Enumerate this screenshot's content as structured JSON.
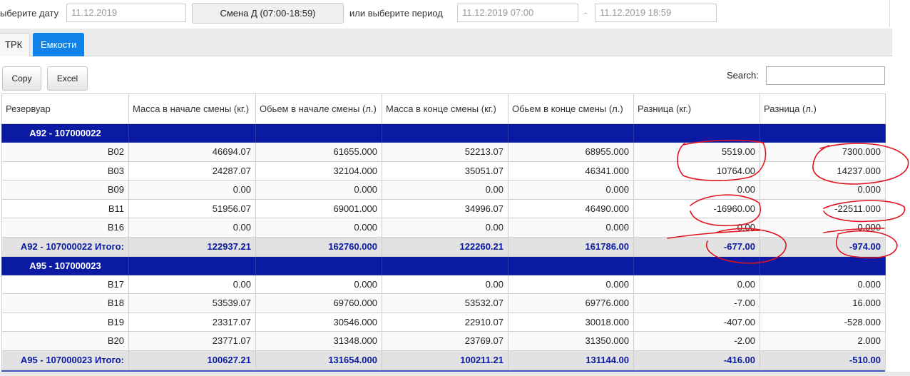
{
  "filters": {
    "date_label": "ыберите дату",
    "date_value": "11.12.2019",
    "shift_button": "Смена Д (07:00-18:59)",
    "period_label": "или выберите период",
    "period_from": "11.12.2019 07:00",
    "period_dash": "-",
    "period_to": "11.12.2019 18:59"
  },
  "tabs": [
    {
      "label": "ТРК",
      "active": false
    },
    {
      "label": "Емкости",
      "active": true
    }
  ],
  "toolbar": {
    "copy_label": "Copy",
    "excel_label": "Excel",
    "search_label": "Search:",
    "search_value": ""
  },
  "table": {
    "headers": [
      "Резервуар",
      "Масса в начале смены (кг.)",
      "Обьем в начале смены (л.)",
      "Масса в конце смены (кг.)",
      "Обьем в конце смены (л.)",
      "Разница (кг.)",
      "Разница (л.)"
    ],
    "groups": [
      {
        "name": "А92 - 107000022",
        "rows": [
          [
            "В02",
            "46694.07",
            "61655.000",
            "52213.07",
            "68955.000",
            "5519.00",
            "7300.000"
          ],
          [
            "В03",
            "24287.07",
            "32104.000",
            "35051.07",
            "46341.000",
            "10764.00",
            "14237.000"
          ],
          [
            "В09",
            "0.00",
            "0.000",
            "0.00",
            "0.000",
            "0.00",
            "0.000"
          ],
          [
            "В11",
            "51956.07",
            "69001.000",
            "34996.07",
            "46490.000",
            "-16960.00",
            "-22511.000"
          ],
          [
            "В16",
            "0.00",
            "0.000",
            "0.00",
            "0.000",
            "0.00",
            "0.000"
          ]
        ],
        "total": [
          "А92 - 107000022 Итого:",
          "122937.21",
          "162760.000",
          "122260.21",
          "161786.00",
          "-677.00",
          "-974.00"
        ]
      },
      {
        "name": "А95 - 107000023",
        "rows": [
          [
            "В17",
            "0.00",
            "0.000",
            "0.00",
            "0.000",
            "0.00",
            "0.000"
          ],
          [
            "В18",
            "53539.07",
            "69760.000",
            "53532.07",
            "69776.000",
            "-7.00",
            "16.000"
          ],
          [
            "В19",
            "23317.07",
            "30546.000",
            "22910.07",
            "30018.000",
            "-407.00",
            "-528.000"
          ],
          [
            "В20",
            "23771.07",
            "31348.000",
            "23769.07",
            "31350.000",
            "-2.00",
            "2.000"
          ]
        ],
        "total": [
          "А95 - 107000023 Итого:",
          "100627.21",
          "131654.000",
          "100211.21",
          "131144.00",
          "-416.00",
          "-510.00"
        ]
      }
    ]
  },
  "colors": {
    "group_header_bg": "#0a1aa2",
    "total_text": "#0a1aa2",
    "active_tab": "#0f83e8",
    "annotation_red": "#e0141e"
  }
}
